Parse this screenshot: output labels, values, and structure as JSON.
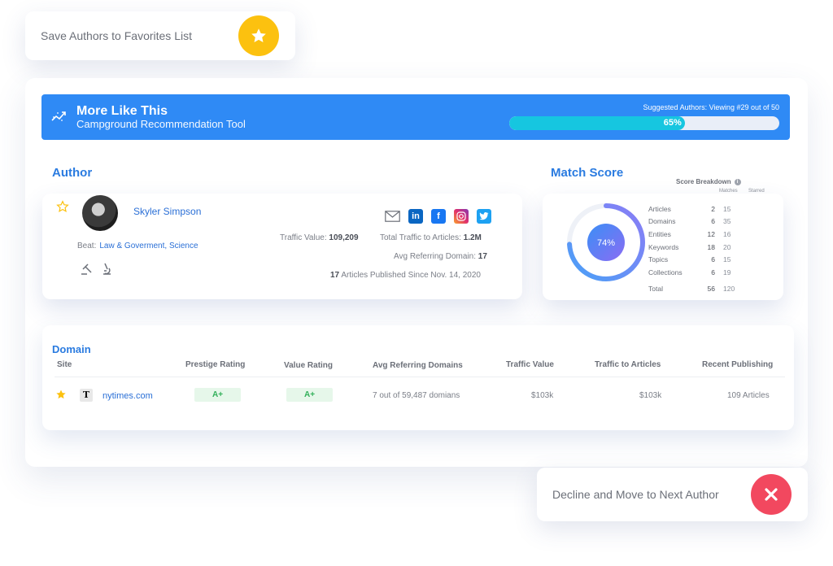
{
  "save": {
    "label": "Save Authors to Favorites List",
    "icon": "star-icon",
    "color": "#fcc10f"
  },
  "decline": {
    "label": "Decline and Move to Next Author",
    "icon": "close-icon",
    "color": "#f2485f"
  },
  "banner": {
    "title": "More Like This",
    "subtitle": "Campground Recommendation Tool",
    "suggested": "Suggested Authors: Viewing #29 out of 50",
    "progress_label": "65%",
    "progress_value": 0.65,
    "color": "#2f8af5"
  },
  "author": {
    "section_title": "Author",
    "name": "Skyler Simpson",
    "beat_label": "Beat:",
    "beat_value": "Law & Goverment, Science",
    "traffic_value_label": "Traffic Value:",
    "traffic_value": "109,209",
    "traffic_articles_label": "Total Traffic to Articles:",
    "traffic_articles": "1.2M",
    "avg_ref_label": "Avg Referring Domain:",
    "avg_ref": "17",
    "articles_count": "17",
    "articles_label": "Articles Published Since Nov. 14, 2020",
    "socials": [
      "email-icon",
      "linkedin-icon",
      "facebook-icon",
      "instagram-icon",
      "twitter-icon"
    ]
  },
  "match": {
    "section_title": "Match Score",
    "score_label": "74%",
    "score_value": 0.74,
    "breakdown_title": "Score Breakdown",
    "col_matches": "Matches",
    "col_starred": "Starred",
    "rows": [
      {
        "name": "Articles",
        "matches": "2",
        "starred": "15"
      },
      {
        "name": "Domains",
        "matches": "6",
        "starred": "35"
      },
      {
        "name": "Entities",
        "matches": "12",
        "starred": "16"
      },
      {
        "name": "Keywords",
        "matches": "18",
        "starred": "20"
      },
      {
        "name": "Topics",
        "matches": "6",
        "starred": "15"
      },
      {
        "name": "Collections",
        "matches": "6",
        "starred": "19"
      }
    ],
    "total": {
      "name": "Total",
      "matches": "56",
      "starred": "120"
    }
  },
  "domain": {
    "section_title": "Domain",
    "headers": {
      "site": "Site",
      "prestige": "Prestige Rating",
      "value": "Value Rating",
      "avg_ref": "Avg Referring Domains",
      "traffic_value": "Traffic Value",
      "traffic_articles": "Traffic to Articles",
      "recent": "Recent Publishing"
    },
    "row": {
      "site": "nytimes.com",
      "site_logo": "T",
      "prestige": "A+",
      "value": "A+",
      "avg_ref": "7 out of 59,487 domians",
      "traffic_value": "$103k",
      "traffic_articles": "$103k",
      "recent": "109 Articles"
    }
  }
}
